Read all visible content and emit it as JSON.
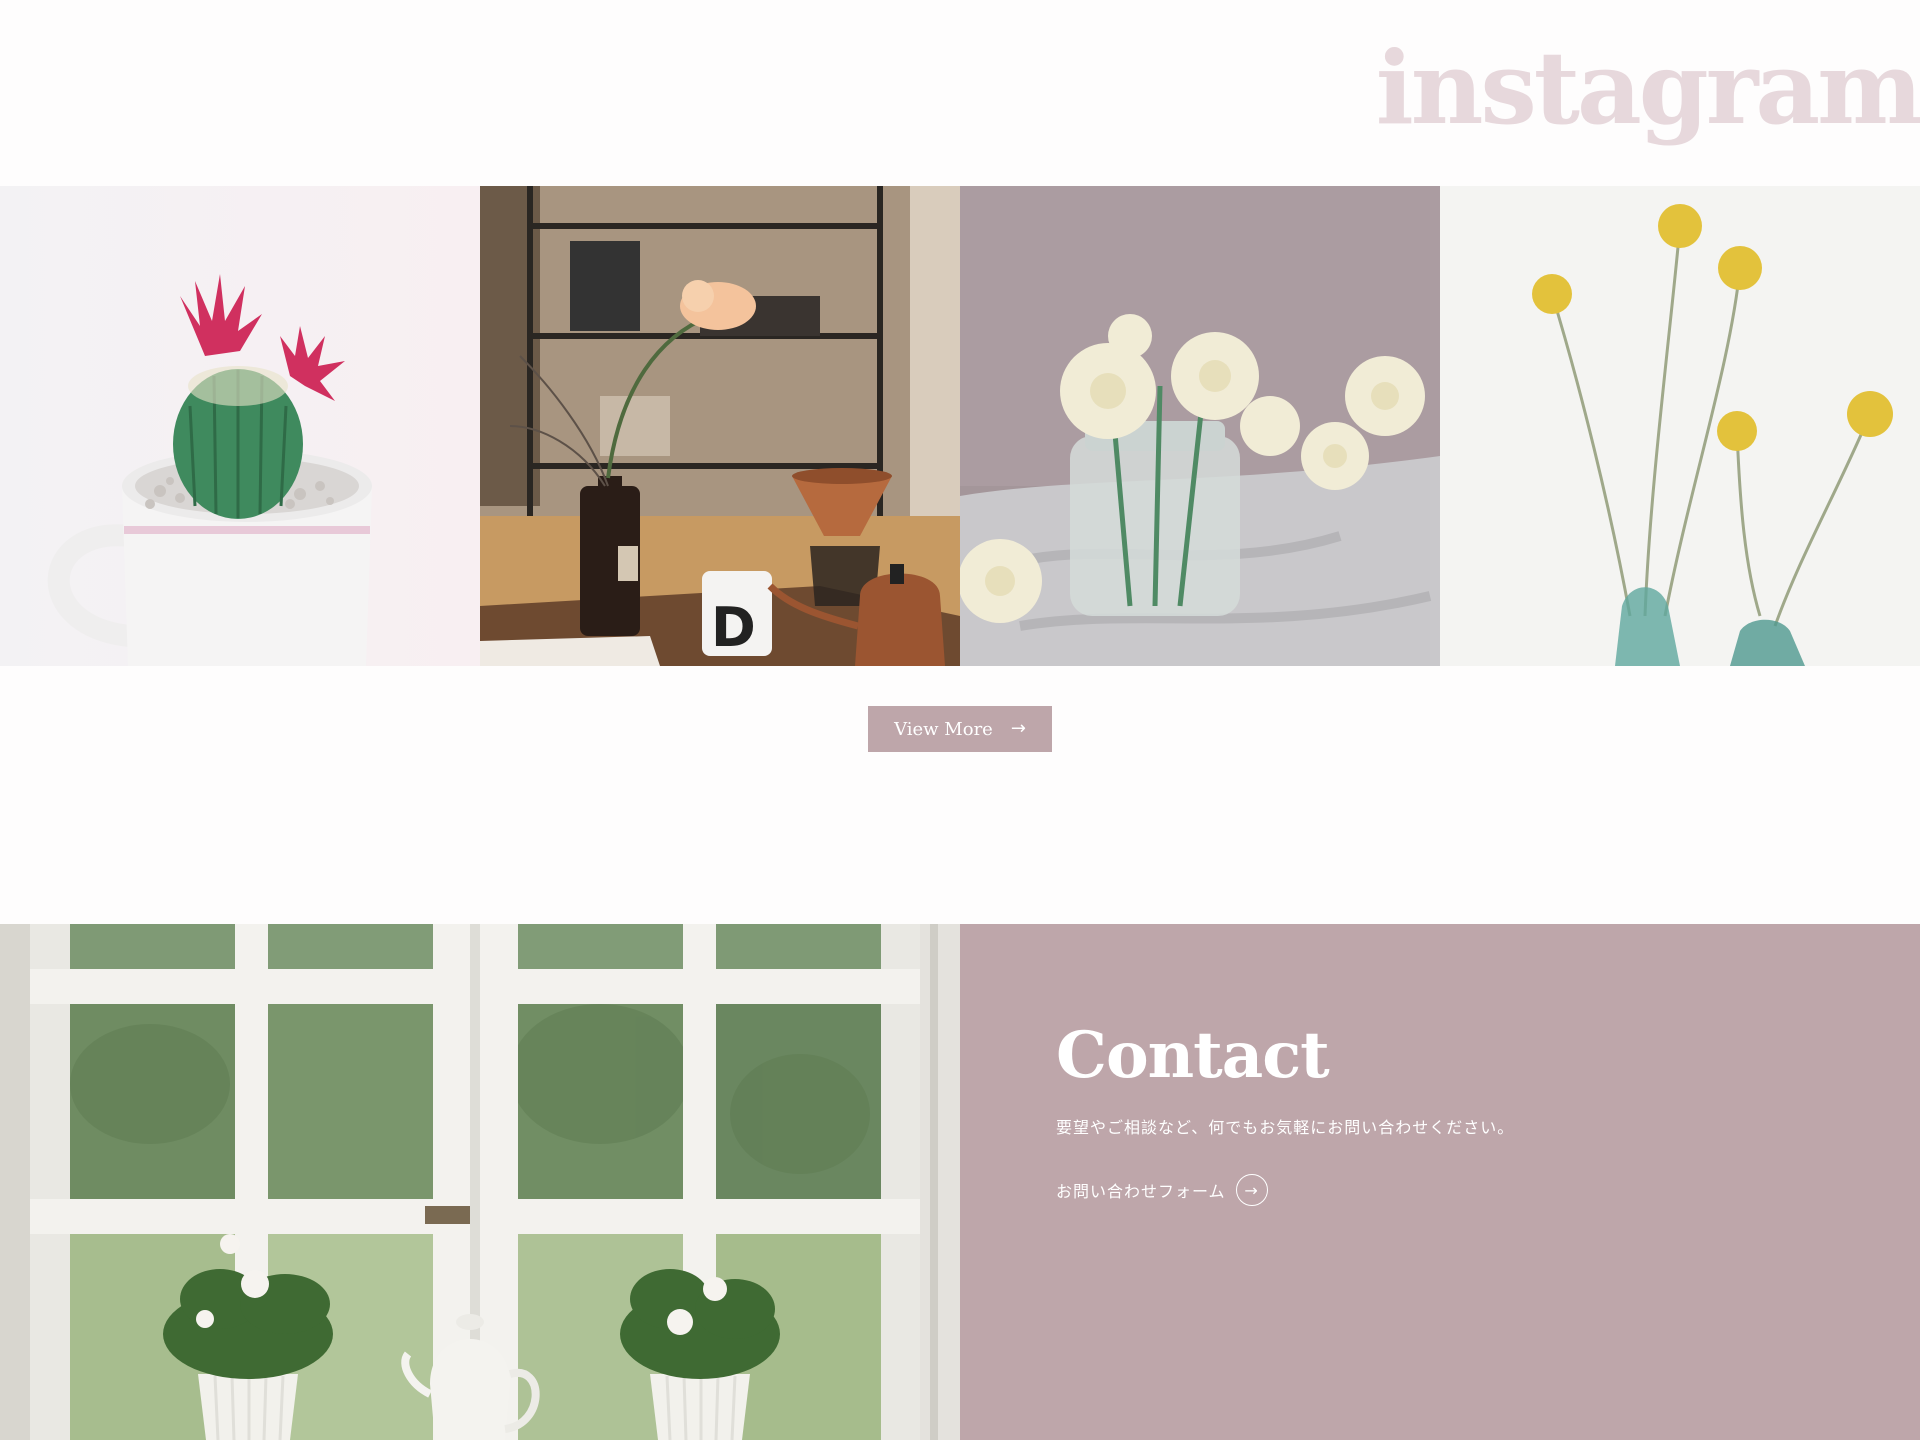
{
  "instagram": {
    "title": "instagram",
    "title_color": "#e7d8dc",
    "photos": [
      {
        "name": "cactus-in-mug-photo"
      },
      {
        "name": "flower-vase-coffee-table-photo"
      },
      {
        "name": "white-roses-glass-jar-photo"
      },
      {
        "name": "yellow-craspedia-flowers-photo"
      }
    ],
    "view_more_label": "View More",
    "view_more_arrow": "→"
  },
  "contact": {
    "heading": "Contact",
    "description": "要望やご相談など、何でもお気軽にお問い合わせください。",
    "form_link_label": "お問い合わせフォーム",
    "form_link_arrow": "→",
    "panel_color": "#bea6aa"
  }
}
